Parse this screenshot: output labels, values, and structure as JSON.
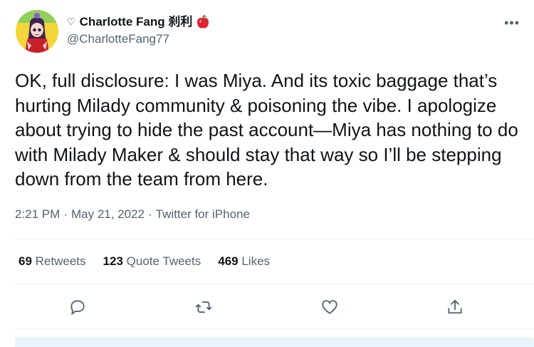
{
  "author": {
    "display_name": "Charlotte Fang 刹利",
    "heart_prefix": "♡",
    "handle": "@CharlotteFang77",
    "avatar_icon": "avatar-anime-girl",
    "badge_icon": "red-apple-icon"
  },
  "tweet": {
    "text": "OK, full disclosure: I was Miya. And its toxic baggage that’s hurting Milady community & poisoning the vibe. I apologize about trying to hide the past account—Miya has nothing to do with Milady Maker & should stay that way so I’ll be stepping down from the team from here.",
    "time": "2:21 PM",
    "date": "May 21, 2022",
    "source": "Twitter for iPhone",
    "separator": "·"
  },
  "stats": {
    "retweets_count": "69",
    "retweets_label": "Retweets",
    "quotes_count": "123",
    "quotes_label": "Quote Tweets",
    "likes_count": "469",
    "likes_label": "Likes"
  },
  "menu": {
    "more_label": "•••"
  },
  "colors": {
    "text": "#0f1419",
    "secondary": "#536471",
    "divider": "#eff3f4",
    "reply_bg": "#eaf4fb"
  }
}
